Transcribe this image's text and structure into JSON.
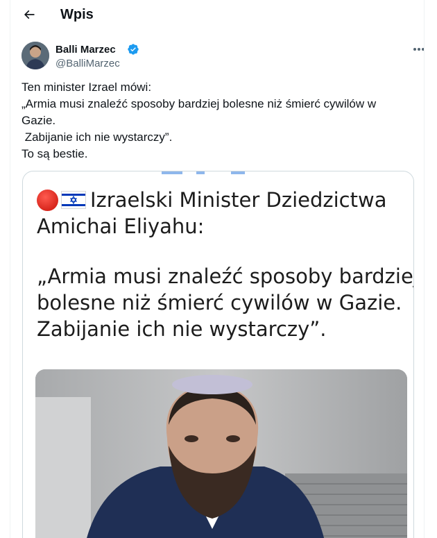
{
  "header": {
    "title": "Wpis",
    "back_icon": "arrow-left-icon"
  },
  "author": {
    "display_name": "Balli Marzec",
    "handle": "@BalliMarzec",
    "verified": true,
    "verified_color": "#1d9bf0"
  },
  "tweet": {
    "lines": [
      "Ten minister Izrael mówi:",
      "„Armia musi znaleźć sposoby bardziej bolesne niż śmierć cywilów w",
      "Gazie.",
      " Zabijanie ich nie wystarczy”.",
      "To są bestie."
    ]
  },
  "media": {
    "lines": [
      "Izraelski Minister Dziedzictwa",
      "Amichai Eliyahu:",
      "„Armia musi znaleźć sposoby bardziej",
      "bolesne niż śmierć cywilów w Gazie.",
      "Zabijanie ich nie wystarczy”."
    ],
    "icons": [
      "red-circle-icon",
      "israel-flag-icon"
    ]
  }
}
